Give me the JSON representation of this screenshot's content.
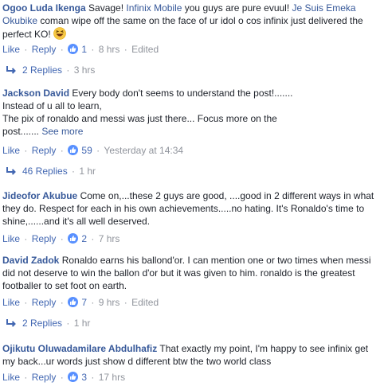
{
  "comments": [
    {
      "author": "Ogoo Luda Ikenga",
      "text_before": "Savage! ",
      "tag1": "Infinix Mobile",
      "text_mid": " you guys are pure evuul! ",
      "tag2": "Je Suis Emeka Okubike",
      "text_after": " coman wipe off the same on the face of ur idol o cos infinix just delivered the perfect KO! ",
      "emoji": "laughing-face",
      "like_label": "Like",
      "reply_label": "Reply",
      "likes": "1",
      "time": "8 hrs",
      "edited": "Edited",
      "replies_label": "2 Replies",
      "replies_time": "3 hrs"
    },
    {
      "author": "Jackson David",
      "line1": "Every body don't seems to understand the post!.......",
      "line2": "Instead of u all to learn,",
      "line3": "The pix of ronaldo and messi was just there... Focus more on the",
      "line4": "post.......",
      "see_more": "See more",
      "like_label": "Like",
      "reply_label": "Reply",
      "likes": "59",
      "time": "Yesterday at 14:34",
      "replies_label": "46 Replies",
      "replies_time": "1 hr"
    },
    {
      "author": "Jideofor Akubue",
      "text": "Come on,...these 2 guys are good, ....good in 2 different ways in what they do. Respect for each in his own achievements.....no hating. It's Ronaldo's time to shine,......and it's all well deserved.",
      "like_label": "Like",
      "reply_label": "Reply",
      "likes": "2",
      "time": "7 hrs"
    },
    {
      "author": "David Zadok",
      "text": "Ronaldo earns his ballond'or. I can mention one or two times when messi did not deserve to win the ballon d'or but it was given to him. ronaldo is the greatest footballer to set foot on earth.",
      "like_label": "Like",
      "reply_label": "Reply",
      "likes": "7",
      "time": "9 hrs",
      "edited": "Edited",
      "replies_label": "2 Replies",
      "replies_time": "1 hr"
    },
    {
      "author": "Ojikutu Oluwadamilare Abdulhafiz",
      "text": "That exactly my point, I'm happy to see infinix get my back...ur words just show d different btw the two world class",
      "like_label": "Like",
      "reply_label": "Reply",
      "likes": "3",
      "time": "17 hrs"
    }
  ],
  "colors": {
    "link": "#365899",
    "action": "#4267b2",
    "meta": "#90949c",
    "text": "#1d2129",
    "like_badge": "#5890ff"
  }
}
